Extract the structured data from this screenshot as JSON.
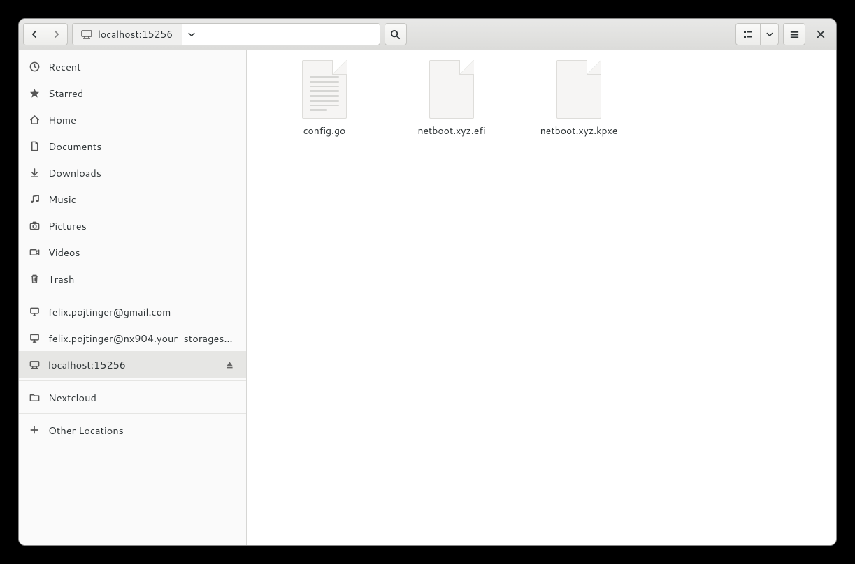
{
  "header": {
    "location_label": "localhost:15256"
  },
  "sidebar": {
    "places": [
      {
        "id": "recent",
        "label": "Recent",
        "icon": "clock"
      },
      {
        "id": "starred",
        "label": "Starred",
        "icon": "star"
      },
      {
        "id": "home",
        "label": "Home",
        "icon": "home"
      },
      {
        "id": "documents",
        "label": "Documents",
        "icon": "document"
      },
      {
        "id": "downloads",
        "label": "Downloads",
        "icon": "download"
      },
      {
        "id": "music",
        "label": "Music",
        "icon": "music"
      },
      {
        "id": "pictures",
        "label": "Pictures",
        "icon": "camera"
      },
      {
        "id": "videos",
        "label": "Videos",
        "icon": "video"
      },
      {
        "id": "trash",
        "label": "Trash",
        "icon": "trash"
      }
    ],
    "mounts": [
      {
        "id": "mount-0",
        "label": "felix.pojtinger@gmail.com",
        "icon": "remote",
        "ejectable": false,
        "selected": false
      },
      {
        "id": "mount-1",
        "label": "felix.pojtinger@nx904.your-storagesh…",
        "icon": "remote",
        "ejectable": false,
        "selected": false
      },
      {
        "id": "mount-2",
        "label": "localhost:15256",
        "icon": "network",
        "ejectable": true,
        "selected": true
      }
    ],
    "bookmarks": [
      {
        "id": "nextcloud",
        "label": "Nextcloud",
        "icon": "folder"
      }
    ],
    "other": {
      "label": "Other Locations"
    }
  },
  "files": [
    {
      "name": "config.go",
      "type": "text"
    },
    {
      "name": "netboot.xyz.efi",
      "type": "blank"
    },
    {
      "name": "netboot.xyz.kpxe",
      "type": "blank"
    }
  ]
}
